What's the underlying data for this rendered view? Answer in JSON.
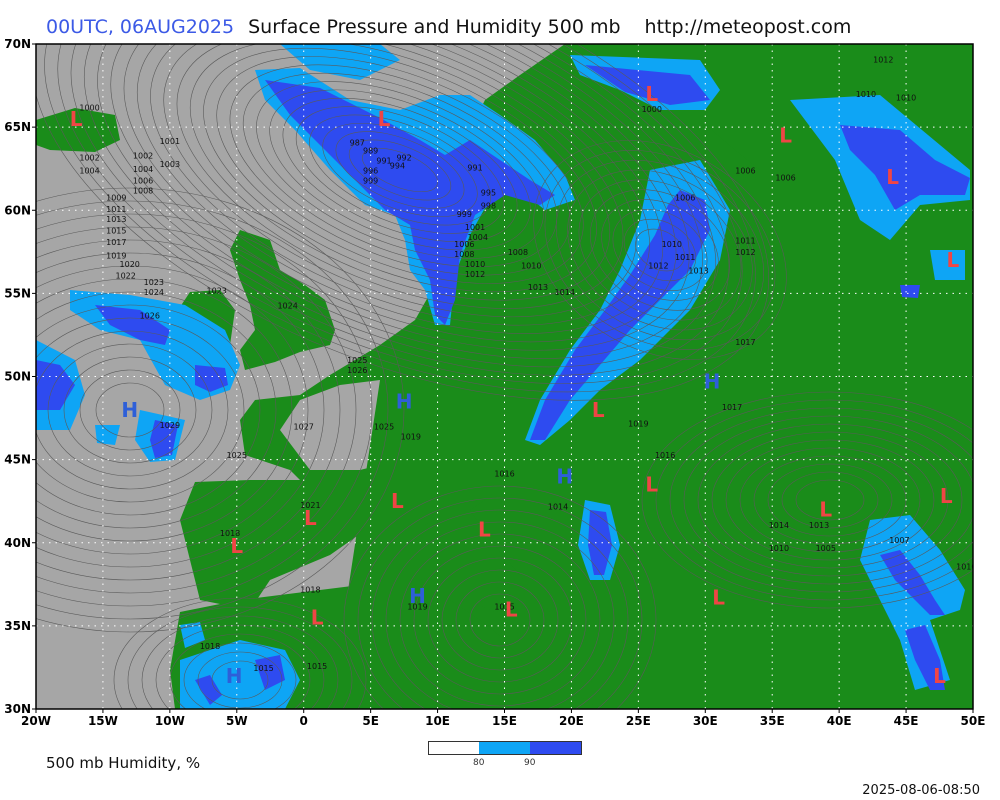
{
  "header": {
    "run": "00UTC, 06AUG2025",
    "product": "Surface Pressure and Humidity 500 mb",
    "site": "http://meteopost.com"
  },
  "map": {
    "domain": {
      "lon": [
        -20,
        50
      ],
      "lat": [
        30,
        70
      ]
    },
    "lat_labels": [
      "70N",
      "65N",
      "60N",
      "55N",
      "50N",
      "45N",
      "40N",
      "35N",
      "30N"
    ],
    "lon_labels": [
      "20W",
      "15W",
      "10W",
      "5W",
      "0",
      "5E",
      "10E",
      "15E",
      "20E",
      "25E",
      "30E",
      "35E",
      "40E",
      "45E",
      "50E"
    ],
    "colors": {
      "sea": "#a6a6a6",
      "land": "#1a8c1a",
      "humidity_80": "#0ea5f5",
      "humidity_90": "#2e4bf0",
      "low": "#f04545",
      "high": "#2e5fd8"
    },
    "pressure_centres": [
      {
        "type": "L",
        "lon": -17,
        "lat": 65.5
      },
      {
        "type": "L",
        "lon": 6,
        "lat": 65.5
      },
      {
        "type": "L",
        "lon": 26,
        "lat": 67
      },
      {
        "type": "L",
        "lon": 36,
        "lat": 64.5
      },
      {
        "type": "L",
        "lon": 44,
        "lat": 62
      },
      {
        "type": "L",
        "lon": 48.5,
        "lat": 57
      },
      {
        "type": "H",
        "lon": -13,
        "lat": 48
      },
      {
        "type": "H",
        "lon": 7.5,
        "lat": 48.5
      },
      {
        "type": "H",
        "lon": 30.5,
        "lat": 49.7
      },
      {
        "type": "L",
        "lon": 22,
        "lat": 48
      },
      {
        "type": "L",
        "lon": 7,
        "lat": 42.5
      },
      {
        "type": "L",
        "lon": 0.5,
        "lat": 41.5
      },
      {
        "type": "L",
        "lon": -5,
        "lat": 39.8
      },
      {
        "type": "L",
        "lon": 13.5,
        "lat": 40.8
      },
      {
        "type": "H",
        "lon": 19.5,
        "lat": 44
      },
      {
        "type": "L",
        "lon": 26,
        "lat": 43.5
      },
      {
        "type": "L",
        "lon": 39,
        "lat": 42
      },
      {
        "type": "L",
        "lon": 48,
        "lat": 42.8
      },
      {
        "type": "L",
        "lon": 1,
        "lat": 35.5
      },
      {
        "type": "H",
        "lon": 8.5,
        "lat": 36.8
      },
      {
        "type": "L",
        "lon": 15.5,
        "lat": 36
      },
      {
        "type": "L",
        "lon": 31,
        "lat": 36.7
      },
      {
        "type": "H",
        "lon": -5.2,
        "lat": 32
      },
      {
        "type": "L",
        "lon": 47.5,
        "lat": 32
      }
    ],
    "isobar_labels": [
      {
        "text": "1000",
        "lon": -16,
        "lat": 66
      },
      {
        "text": "1001",
        "lon": -10,
        "lat": 64
      },
      {
        "text": "1002",
        "lon": -16,
        "lat": 63
      },
      {
        "text": "1002",
        "lon": -12,
        "lat": 63.1
      },
      {
        "text": "1003",
        "lon": -10,
        "lat": 62.6
      },
      {
        "text": "1004",
        "lon": -16,
        "lat": 62.2
      },
      {
        "text": "1004",
        "lon": -12,
        "lat": 62.3
      },
      {
        "text": "1006",
        "lon": -12,
        "lat": 61.6
      },
      {
        "text": "1008",
        "lon": -12,
        "lat": 61
      },
      {
        "text": "1009",
        "lon": -14,
        "lat": 60.6
      },
      {
        "text": "1011",
        "lon": -14,
        "lat": 59.9
      },
      {
        "text": "1013",
        "lon": -14,
        "lat": 59.3
      },
      {
        "text": "1015",
        "lon": -14,
        "lat": 58.6
      },
      {
        "text": "1017",
        "lon": -14,
        "lat": 57.9
      },
      {
        "text": "1019",
        "lon": -14,
        "lat": 57.1
      },
      {
        "text": "1020",
        "lon": -13,
        "lat": 56.6
      },
      {
        "text": "1022",
        "lon": -13.3,
        "lat": 55.9
      },
      {
        "text": "1023",
        "lon": -11.2,
        "lat": 55.5
      },
      {
        "text": "1024",
        "lon": -11.2,
        "lat": 54.9
      },
      {
        "text": "1023",
        "lon": -6.5,
        "lat": 55
      },
      {
        "text": "1026",
        "lon": -11.5,
        "lat": 53.5
      },
      {
        "text": "1024",
        "lon": -1.2,
        "lat": 54.1
      },
      {
        "text": "1029",
        "lon": -10,
        "lat": 46.9
      },
      {
        "text": "1027",
        "lon": 0,
        "lat": 46.8
      },
      {
        "text": "1025",
        "lon": -5,
        "lat": 45.1
      },
      {
        "text": "1025",
        "lon": 4,
        "lat": 50.8
      },
      {
        "text": "1026",
        "lon": 4,
        "lat": 50.2
      },
      {
        "text": "1025",
        "lon": 6,
        "lat": 46.8
      },
      {
        "text": "1019",
        "lon": 8,
        "lat": 46.2
      },
      {
        "text": "987",
        "lon": 4,
        "lat": 63.9
      },
      {
        "text": "989",
        "lon": 5,
        "lat": 63.4
      },
      {
        "text": "991",
        "lon": 6,
        "lat": 62.8
      },
      {
        "text": "992",
        "lon": 7.5,
        "lat": 63
      },
      {
        "text": "994",
        "lon": 7,
        "lat": 62.5
      },
      {
        "text": "996",
        "lon": 5,
        "lat": 62.2
      },
      {
        "text": "999",
        "lon": 5,
        "lat": 61.6
      },
      {
        "text": "991",
        "lon": 12.8,
        "lat": 62.4
      },
      {
        "text": "995",
        "lon": 13.8,
        "lat": 60.9
      },
      {
        "text": "998",
        "lon": 13.8,
        "lat": 60.1
      },
      {
        "text": "999",
        "lon": 12,
        "lat": 59.6
      },
      {
        "text": "1001",
        "lon": 12.8,
        "lat": 58.8
      },
      {
        "text": "1004",
        "lon": 13,
        "lat": 58.2
      },
      {
        "text": "1006",
        "lon": 12,
        "lat": 57.8
      },
      {
        "text": "1008",
        "lon": 12,
        "lat": 57.2
      },
      {
        "text": "1010",
        "lon": 12.8,
        "lat": 56.6
      },
      {
        "text": "1012",
        "lon": 12.8,
        "lat": 56
      },
      {
        "text": "1008",
        "lon": 16,
        "lat": 57.3
      },
      {
        "text": "1010",
        "lon": 17,
        "lat": 56.5
      },
      {
        "text": "1013",
        "lon": 17.5,
        "lat": 55.2
      },
      {
        "text": "1014",
        "lon": 19.5,
        "lat": 54.9
      },
      {
        "text": "1000",
        "lon": 26,
        "lat": 65.9
      },
      {
        "text": "1006",
        "lon": 28.5,
        "lat": 60.6
      },
      {
        "text": "1006",
        "lon": 33,
        "lat": 62.2
      },
      {
        "text": "1006",
        "lon": 36,
        "lat": 61.8
      },
      {
        "text": "1010",
        "lon": 27.5,
        "lat": 57.8
      },
      {
        "text": "1011",
        "lon": 28.5,
        "lat": 57
      },
      {
        "text": "1012",
        "lon": 26.5,
        "lat": 56.5
      },
      {
        "text": "1013",
        "lon": 29.5,
        "lat": 56.2
      },
      {
        "text": "1011",
        "lon": 33,
        "lat": 58
      },
      {
        "text": "1012",
        "lon": 33,
        "lat": 57.3
      },
      {
        "text": "1017",
        "lon": 33,
        "lat": 51.9
      },
      {
        "text": "1017",
        "lon": 32,
        "lat": 48
      },
      {
        "text": "1019",
        "lon": 25,
        "lat": 47
      },
      {
        "text": "1016",
        "lon": 27,
        "lat": 45.1
      },
      {
        "text": "1016",
        "lon": 15,
        "lat": 44
      },
      {
        "text": "1014",
        "lon": 19,
        "lat": 42
      },
      {
        "text": "1012",
        "lon": 43.3,
        "lat": 68.9
      },
      {
        "text": "1010",
        "lon": 42,
        "lat": 66.8
      },
      {
        "text": "1010",
        "lon": 45,
        "lat": 66.6
      },
      {
        "text": "1014",
        "lon": 35.5,
        "lat": 40.9
      },
      {
        "text": "1013",
        "lon": 38.5,
        "lat": 40.9
      },
      {
        "text": "1010",
        "lon": 35.5,
        "lat": 39.5
      },
      {
        "text": "1005",
        "lon": 39,
        "lat": 39.5
      },
      {
        "text": "1007",
        "lon": 44.5,
        "lat": 40
      },
      {
        "text": "1010",
        "lon": 49.5,
        "lat": 38.4
      },
      {
        "text": "1021",
        "lon": 0.5,
        "lat": 42.1
      },
      {
        "text": "1018",
        "lon": -5.5,
        "lat": 40.4
      },
      {
        "text": "1018",
        "lon": 0.5,
        "lat": 37
      },
      {
        "text": "1019",
        "lon": 8.5,
        "lat": 36
      },
      {
        "text": "1015",
        "lon": 15,
        "lat": 36
      },
      {
        "text": "1018",
        "lon": -7,
        "lat": 33.6
      },
      {
        "text": "1015",
        "lon": -3,
        "lat": 32.3
      },
      {
        "text": "1015",
        "lon": 1,
        "lat": 32.4
      }
    ]
  },
  "legend": {
    "label": "500 mb Humidity, %",
    "ticks": [
      "80",
      "90"
    ]
  },
  "timestamp": "2025-08-06-08:50"
}
